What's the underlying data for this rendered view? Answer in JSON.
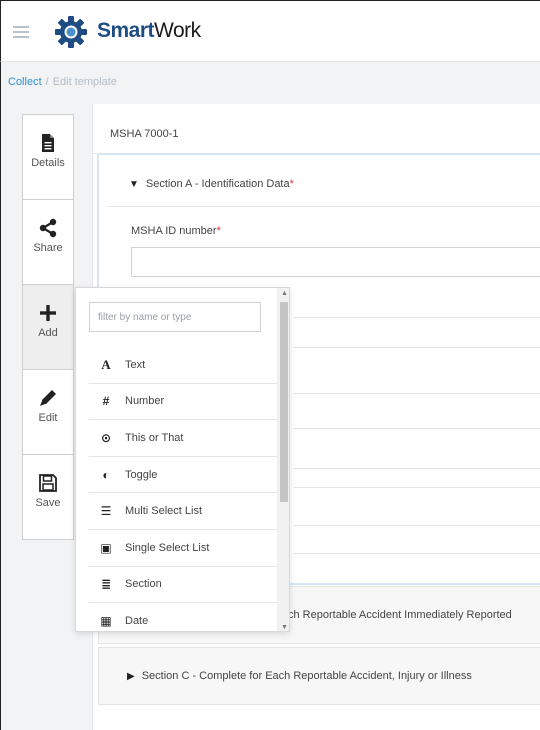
{
  "brand": {
    "part1": "Smart",
    "part2": "Work",
    "accent": "#1f4c82"
  },
  "breadcrumb": {
    "link": "Collect",
    "separator": "/",
    "current": "Edit template"
  },
  "toolbar": {
    "items": [
      {
        "label": "Details",
        "icon": "document-icon"
      },
      {
        "label": "Share",
        "icon": "share-icon"
      },
      {
        "label": "Add",
        "icon": "plus-icon"
      },
      {
        "label": "Edit",
        "icon": "pencil-icon"
      },
      {
        "label": "Save",
        "icon": "floppy-icon"
      }
    ]
  },
  "form": {
    "title": "MSHA 7000-1",
    "sectionA": {
      "title": "Section A - Identification Data",
      "required_mark": "*"
    },
    "field": {
      "label": "MSHA ID number",
      "required_mark": "*",
      "value": ""
    },
    "sectionB": {
      "partial_title": "ch Reportable Accident Immediately Reported"
    },
    "sectionC": {
      "title": "Section C - Complete for Each Reportable Accident, Injury or Illness"
    }
  },
  "dropdown": {
    "filter_placeholder": "filter by name or type",
    "items": [
      {
        "glyph": "A",
        "label": "Text",
        "icon": "text-icon"
      },
      {
        "glyph": "#",
        "label": "Number",
        "icon": "hash-icon"
      },
      {
        "glyph": "⊙",
        "label": "This or That",
        "icon": "radio-icon"
      },
      {
        "glyph": "◐",
        "label": "Toggle",
        "icon": "toggle-icon"
      },
      {
        "glyph": "☰",
        "label": "Multi Select List",
        "icon": "list-icon"
      },
      {
        "glyph": "▣",
        "label": "Single Select List",
        "icon": "select-icon"
      },
      {
        "glyph": "≣",
        "label": "Section",
        "icon": "section-icon"
      },
      {
        "glyph": "▦",
        "label": "Date",
        "icon": "calendar-icon"
      }
    ]
  },
  "colors": {
    "link": "#2e8fd1",
    "required": "#e0312e",
    "section_border": "#d6e6f4"
  }
}
